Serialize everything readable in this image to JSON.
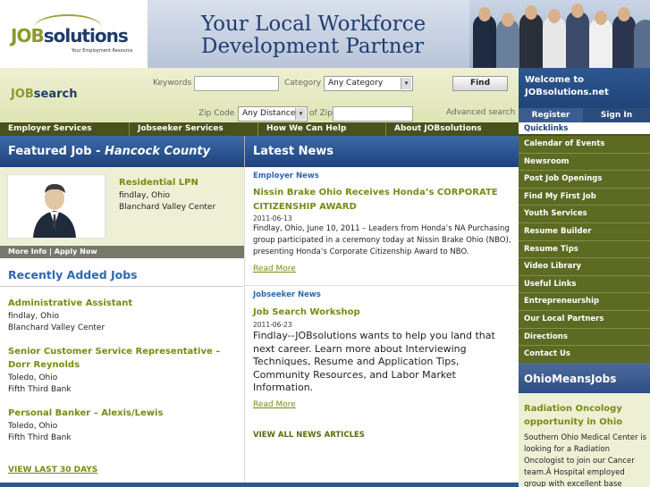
{
  "header": {
    "logo_job": "JOB",
    "logo_rest": "solutions",
    "logo_tagline": "Your Employment Resource",
    "banner_line1": "Your Local Workforce",
    "banner_line2": "Development Partner"
  },
  "search": {
    "logo_job": "JOB",
    "logo_rest": "search",
    "keywords_label": "Keywords",
    "keywords_value": "",
    "category_label": "Category",
    "category_value": "Any Category",
    "find_label": "Find",
    "zip_label": "Zip Code",
    "distance_value": "Any Distance",
    "of_zip_label": "of Zip",
    "zip_value": "",
    "advanced_label": "Advanced search"
  },
  "welcome": {
    "line1": "Welcome to",
    "line2": "JOBsolutions.net",
    "register_label": "Register",
    "signin_label": "Sign In"
  },
  "nav": {
    "employer": "Employer Services",
    "jobseeker": "Jobseeker Services",
    "howhelp": "How We Can Help",
    "about": "About JOBsolutions"
  },
  "featured": {
    "header_prefix": "Featured Job - ",
    "header_county": "Hancock County",
    "title": "Residential LPN",
    "location": "findlay, Ohio",
    "employer": "Blanchard Valley Center",
    "more_info": "More Info | Apply Now"
  },
  "recent": {
    "title": "Recently Added Jobs",
    "jobs": [
      {
        "title": "Administrative Assistant",
        "location": "findlay, Ohio",
        "employer": "Blanchard Valley Center"
      },
      {
        "title": "Senior Customer Service Representative – Dorr Reynolds",
        "location": "Toledo, Ohio",
        "employer": "Fifth Third Bank"
      },
      {
        "title": "Personal Banker – Alexis/Lewis",
        "location": "Toledo, Ohio",
        "employer": "Fifth Third Bank"
      }
    ],
    "view_last": "VIEW LAST 30 DAYS"
  },
  "news": {
    "header": "Latest News",
    "items": [
      {
        "section": "Employer News",
        "title": "Nissin Brake Ohio Receives Honda’s CORPORATE CITIZENSHIP AWARD",
        "date": "2011-06-13",
        "body": "Findlay, Ohio, June 10, 2011 – Leaders from Honda’s NA Purchasing group participated in a ceremony today at Nissin Brake Ohio (NBO), presenting Honda’s Corporate Citizenship Award to NBO.",
        "read_more": "Read More"
      },
      {
        "section": "Jobseeker News",
        "title": "Job Search Workshop",
        "date": "2011-06-23",
        "body": "Findlay--JOBsolutions wants to help you land that next career. Learn more about Interviewing Techniques, Resume and Application Tips, Community Resources, and Labor Market Information.",
        "read_more": "Read More"
      }
    ],
    "view_all": "VIEW ALL NEWS ARTICLES"
  },
  "quicklinks": {
    "header": "Quicklinks",
    "items": [
      "Calendar of Events",
      "Newsroom",
      "Post Job Openings",
      "Find My First Job",
      "Youth Services",
      "Resume Builder",
      "Resume Tips",
      "Video Library",
      "Useful Links",
      "Entrepreneurship",
      "Our Local Partners",
      "Directions",
      "Contact Us"
    ]
  },
  "ohiomeansjobs": {
    "header": "OhioMeansJobs",
    "title": "Radiation Oncology opportunity in Ohio",
    "text": "Southern Ohio Medical Center is looking for a Radiation Oncologist to join our Cancer team.Â  Hospital employed group with excellent base"
  },
  "colors": {
    "brand_navy": "#1e3b6a",
    "brand_olive": "#7a8a12",
    "nav_bar": "#48521c",
    "quicklinks_bg": "#5c6a22",
    "header_blue": "#1d427c"
  }
}
